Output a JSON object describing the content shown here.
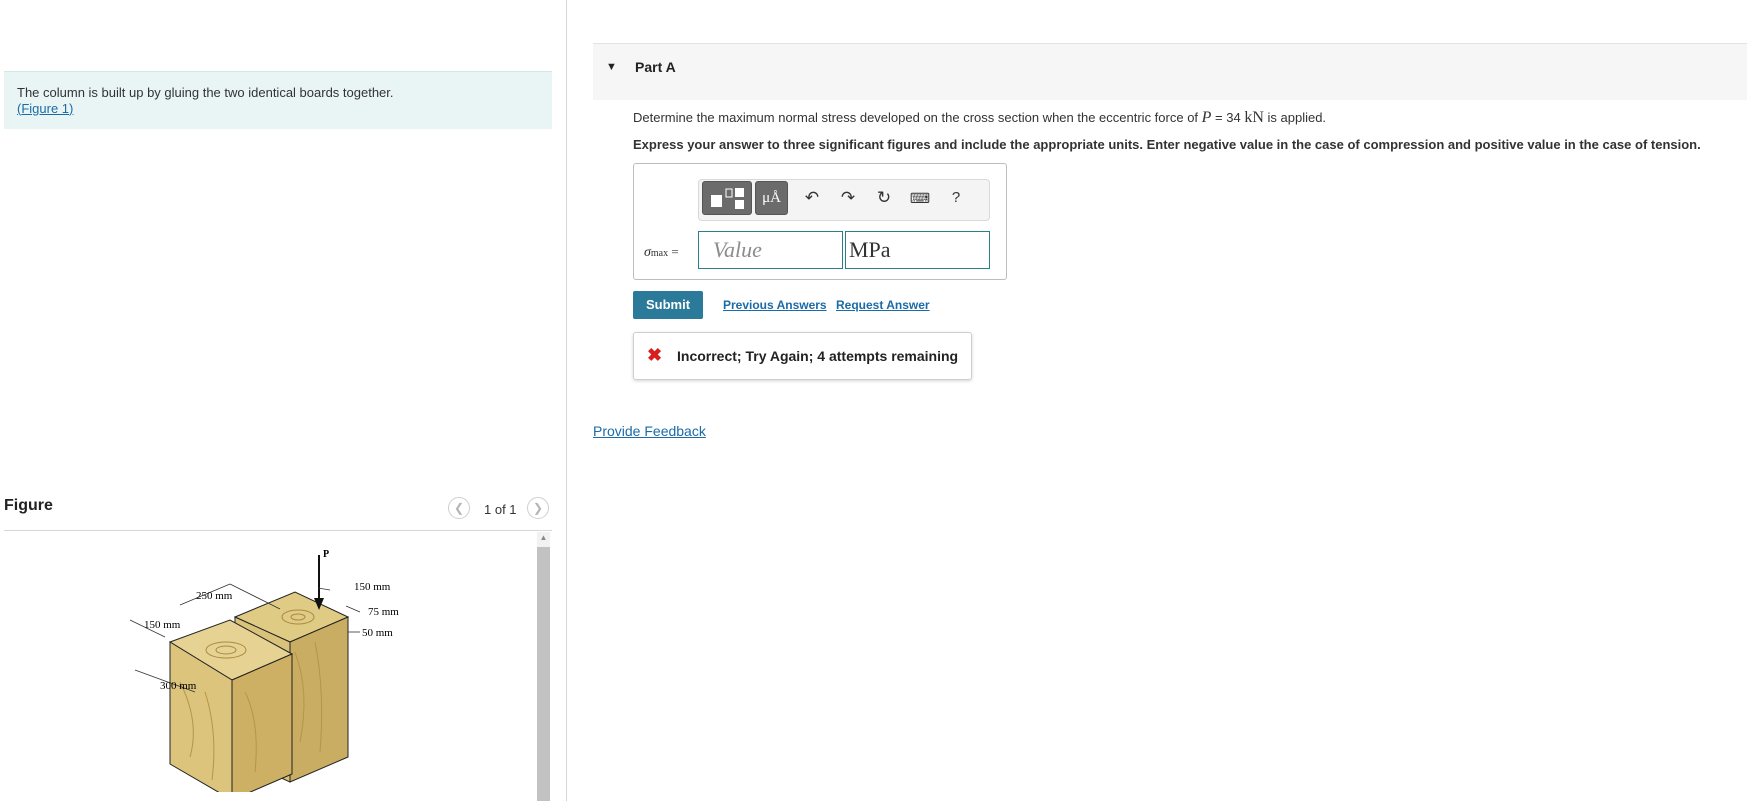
{
  "intro": {
    "text": "The column is built up by gluing the two identical boards together.",
    "figure_link_open": "(",
    "figure_link": "Figure 1",
    "figure_link_close": ")"
  },
  "figure_panel": {
    "title": "Figure",
    "counter": "1 of 1",
    "prev_icon": "chevron-left-icon",
    "next_icon": "chevron-right-icon",
    "labels": {
      "force": "P",
      "dim_250": "250 mm",
      "dim_150_left": "150 mm",
      "dim_300": "300 mm",
      "dim_150_right": "150 mm",
      "dim_75": "75 mm",
      "dim_50": "50 mm"
    },
    "colors": {
      "wood": "#d9c27a",
      "wood_dark": "#c7ab5f",
      "grain": "#a88a43"
    }
  },
  "part": {
    "toggle_icon": "triangle-down-icon",
    "title": "Part A",
    "question_before": "Determine the maximum normal stress developed on the cross section when the eccentric force of ",
    "question_var": "P",
    "question_eq": " = 34 ",
    "question_unit": "kN",
    "question_after": " is applied.",
    "instructions": "Express your answer to three significant figures and include the appropriate units. Enter negative value in the case of compression and positive value in the case of tension."
  },
  "toolbar": {
    "templates_icon": "templates-icon",
    "symbols_label": "μÅ",
    "undo_label": "↶",
    "redo_label": "↷",
    "reset_label": "↻",
    "keyboard_label": "⌨",
    "help_label": "?"
  },
  "answer": {
    "symbol": "σ",
    "subscript": "max",
    "equals": " =",
    "value_placeholder": "Value",
    "unit_value": "MPa"
  },
  "actions": {
    "submit": "Submit",
    "previous_answers": "Previous Answers",
    "request_answer": "Request Answer"
  },
  "feedback": {
    "icon": "✖",
    "text": "Incorrect; Try Again; 4 attempts remaining",
    "icon_color": "#d81e1e"
  },
  "provide_feedback": "Provide Feedback",
  "colors": {
    "accent": "#2b7a99",
    "link": "#1a6ba8",
    "intro_bg": "#e9f5f5"
  }
}
